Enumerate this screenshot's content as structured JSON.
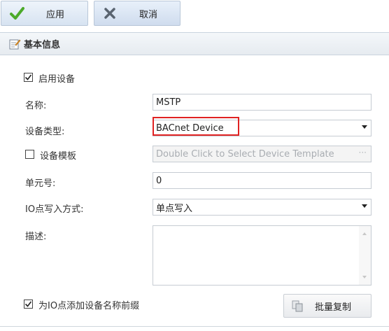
{
  "toolbar": {
    "apply_label": "应用",
    "cancel_label": "取消",
    "apply_icon": "checkmark-icon",
    "cancel_icon": "x-icon"
  },
  "section": {
    "title": "基本信息",
    "icon": "edit-document-icon"
  },
  "form": {
    "enable_device_label": "启用设备",
    "enable_device_checked": true,
    "name_label": "名称:",
    "name_value": "MSTP",
    "device_type_label": "设备类型:",
    "device_type_value": "BACnet Device",
    "device_template_label": "设备模板",
    "device_template_checked": false,
    "device_template_placeholder": "Double Click to Select Device Template",
    "unit_number_label": "单元号:",
    "unit_number_value": "0",
    "io_write_label": "IO点写入方式:",
    "io_write_value": "单点写入",
    "description_label": "描述:",
    "description_value": "",
    "prefix_label": "为IO点添加设备名称前缀",
    "prefix_checked": true,
    "batch_copy_label": "批量复制"
  },
  "colors": {
    "highlight": "#e02222",
    "check_green": "#4caa2a"
  }
}
